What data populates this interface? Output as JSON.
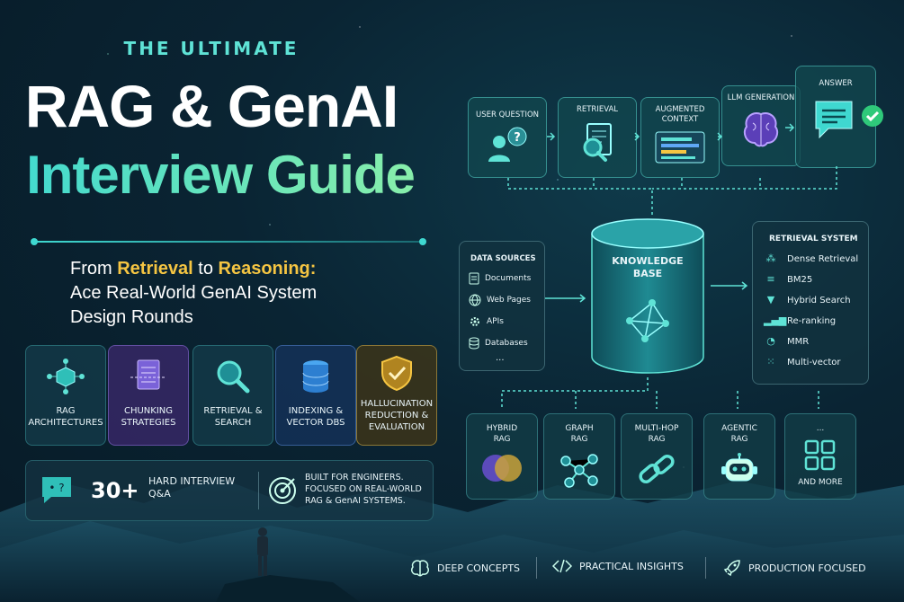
{
  "header": {
    "kicker": "THE ULTIMATE",
    "title_line1": "RAG & GenAI",
    "title_line2": "Interview Guide",
    "subtitle_part1": "From ",
    "subtitle_hl1": "Retrieval",
    "subtitle_part2": " to ",
    "subtitle_hl2": "Reasoning:",
    "subtitle_line2": "Ace Real-World GenAI System",
    "subtitle_line3": "Design Rounds"
  },
  "topics": [
    {
      "label": "RAG Architectures",
      "icon": "cube-network-icon"
    },
    {
      "label": "Chunking Strategies",
      "icon": "document-split-icon"
    },
    {
      "label": "Retrieval & Search",
      "icon": "magnifier-icon"
    },
    {
      "label": "Indexing & Vector DBs",
      "icon": "database-icon"
    },
    {
      "label": "Hallucination Reduction & Evaluation",
      "icon": "shield-check-icon"
    }
  ],
  "promo": {
    "count": "30+",
    "hard_line1": "HARD INTERVIEW",
    "hard_line2": "Q&A",
    "built_line1": "BUILT FOR ENGINEERS.",
    "built_line2": "FOCUSED ON REAL-WORLD",
    "built_line3": "RAG & GenAI SYSTEMS."
  },
  "pipeline": [
    {
      "label": "USER QUESTION",
      "icon": "user-question-icon"
    },
    {
      "label": "RETRIEVAL",
      "icon": "document-search-icon"
    },
    {
      "label": "AUGMENTED CONTEXT",
      "icon": "context-lines-icon"
    },
    {
      "label": "LLM GENERATION",
      "icon": "brain-icon"
    },
    {
      "label": "ANSWER",
      "icon": "chat-bubble-icon"
    }
  ],
  "knowledge_base": {
    "line1": "KNOWLEDGE",
    "line2": "BASE"
  },
  "data_sources": {
    "title": "DATA SOURCES",
    "items": [
      "Documents",
      "Web Pages",
      "APIs",
      "Databases"
    ],
    "more": "..."
  },
  "retrieval_system": {
    "title": "RETRIEVAL SYSTEM",
    "items": [
      "Dense Retrieval",
      "BM25",
      "Hybrid Search",
      "Re-ranking",
      "MMR",
      "Multi-vector"
    ]
  },
  "variants": [
    {
      "label_line1": "HYBRID",
      "label_line2": "RAG"
    },
    {
      "label_line1": "GRAPH",
      "label_line2": "RAG"
    },
    {
      "label_line1": "MULTI-HOP",
      "label_line2": "RAG"
    },
    {
      "label_line1": "AGENTIC",
      "label_line2": "RAG"
    },
    {
      "label_line1": "...",
      "label_line2": "AND MORE"
    }
  ],
  "footer": [
    "DEEP CONCEPTS",
    "PRACTICAL INSIGHTS",
    "PRODUCTION FOCUSED"
  ],
  "colors": {
    "accent": "#5fe3d6",
    "highlight": "#f5c542",
    "background": "#0a2433"
  }
}
